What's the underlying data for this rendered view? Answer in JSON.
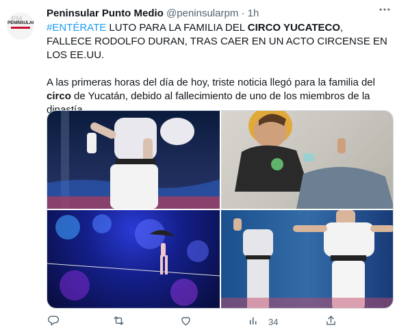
{
  "tweet": {
    "author": {
      "name": "Peninsular Punto Medio",
      "handle": "@peninsularpm",
      "separator": "·",
      "time": "1h",
      "avatar_logo_text": "PENINSULAR",
      "avatar_logo_letters": "PM"
    },
    "text": {
      "hashtag": "#ENTÉRATE",
      "line1_part1": " LUTO PARA LA FAMILIA DEL ",
      "line1_bold": "CIRCO YUCATECO",
      "line1_part2": ", FALLECE RODOLFO DURAN, TRAS CAER EN UN ACTO CIRCENSE EN LOS EE.UU.",
      "para2_part1": "A las primeras horas del día de hoy, triste noticia llegó para la familia del ",
      "para2_bold": "circo",
      "para2_part2": " de Yucatán, debido al fallecimiento de uno de los miembros de la dinastía"
    },
    "media": [
      {
        "name": "performer-on-stage-photo"
      },
      {
        "name": "young-man-portrait-photo"
      },
      {
        "name": "tightrope-act-photo"
      },
      {
        "name": "performer-composite-photo"
      }
    ],
    "actions": {
      "reply_icon": "reply-icon",
      "retweet_icon": "retweet-icon",
      "like_icon": "heart-icon",
      "views_icon": "views-icon",
      "views_count": "34",
      "share_icon": "share-icon"
    },
    "colors": {
      "link": "#1d9bf0",
      "secondary_text": "#536471",
      "primary_text": "#0f1419"
    }
  }
}
